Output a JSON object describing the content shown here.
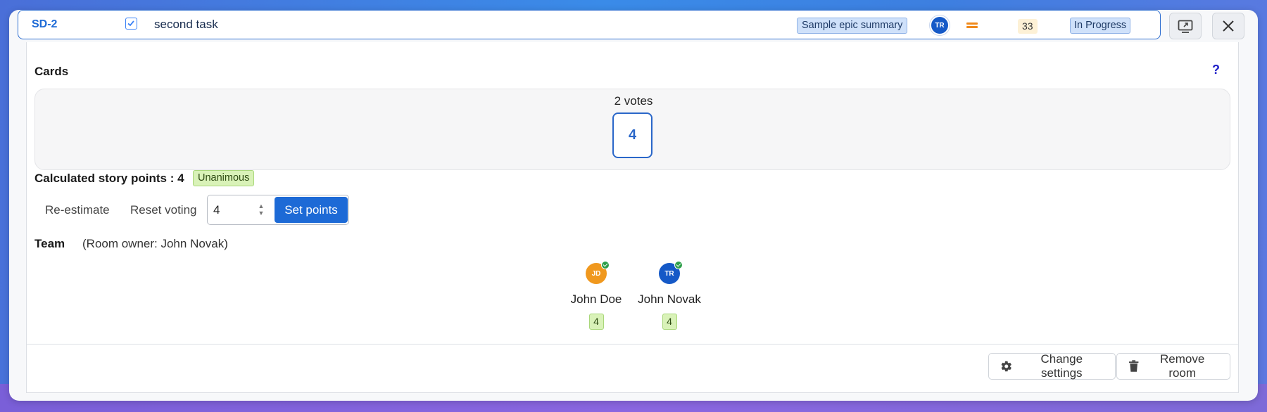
{
  "issue": {
    "key": "SD-2",
    "summary": "second task",
    "epic": "Sample epic summary",
    "assignee_initials": "TR",
    "story_points": "33",
    "status": "In Progress"
  },
  "cards": {
    "title": "Cards",
    "help": "?",
    "votes_label": "2 votes",
    "card_value": "4"
  },
  "result": {
    "calculated_label": "Calculated story points : 4",
    "consensus_badge": "Unanimous"
  },
  "actions": {
    "reestimate": "Re-estimate",
    "reset_voting": "Reset voting",
    "points_value": "4",
    "set_points": "Set points"
  },
  "team": {
    "title": "Team",
    "room_owner": "(Room owner: John Novak)",
    "members": [
      {
        "initials": "JD",
        "name": "John Doe",
        "vote": "4",
        "color": "#f0981e"
      },
      {
        "initials": "TR",
        "name": "John Novak",
        "vote": "4",
        "color": "#1559c7"
      }
    ]
  },
  "footer": {
    "change_settings": "Change settings",
    "remove_room": "Remove room"
  },
  "colors": {
    "accent": "#1d6ad6",
    "success_badge": "#d9f2b8",
    "info_badge": "#cfe1fa"
  }
}
